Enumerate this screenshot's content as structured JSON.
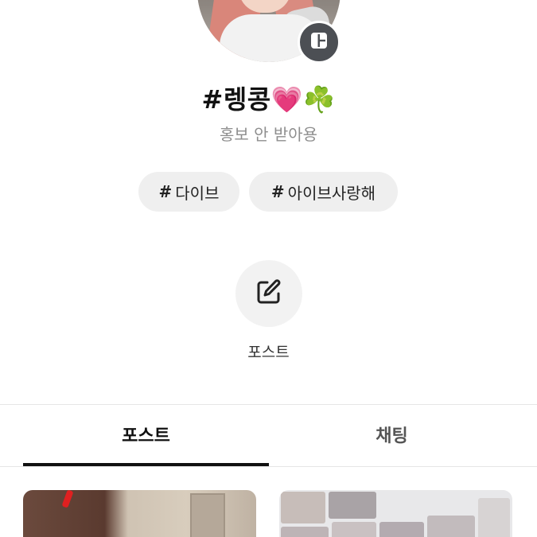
{
  "profile": {
    "title": "#렝콩💗☘️",
    "subtitle": "홍보 안 받아용"
  },
  "tags": [
    {
      "hash": "#",
      "label": "다이브"
    },
    {
      "hash": "#",
      "label": "아이브사랑해"
    }
  ],
  "action": {
    "label": "포스트",
    "icon": "edit-icon"
  },
  "tabs": [
    {
      "label": "포스트",
      "active": true
    },
    {
      "label": "채팅",
      "active": false
    }
  ],
  "colors": {
    "badge": "#4c4f54",
    "tag_bg": "#efefef",
    "subtitle": "#8e8e8e",
    "indicator": "#111111"
  }
}
